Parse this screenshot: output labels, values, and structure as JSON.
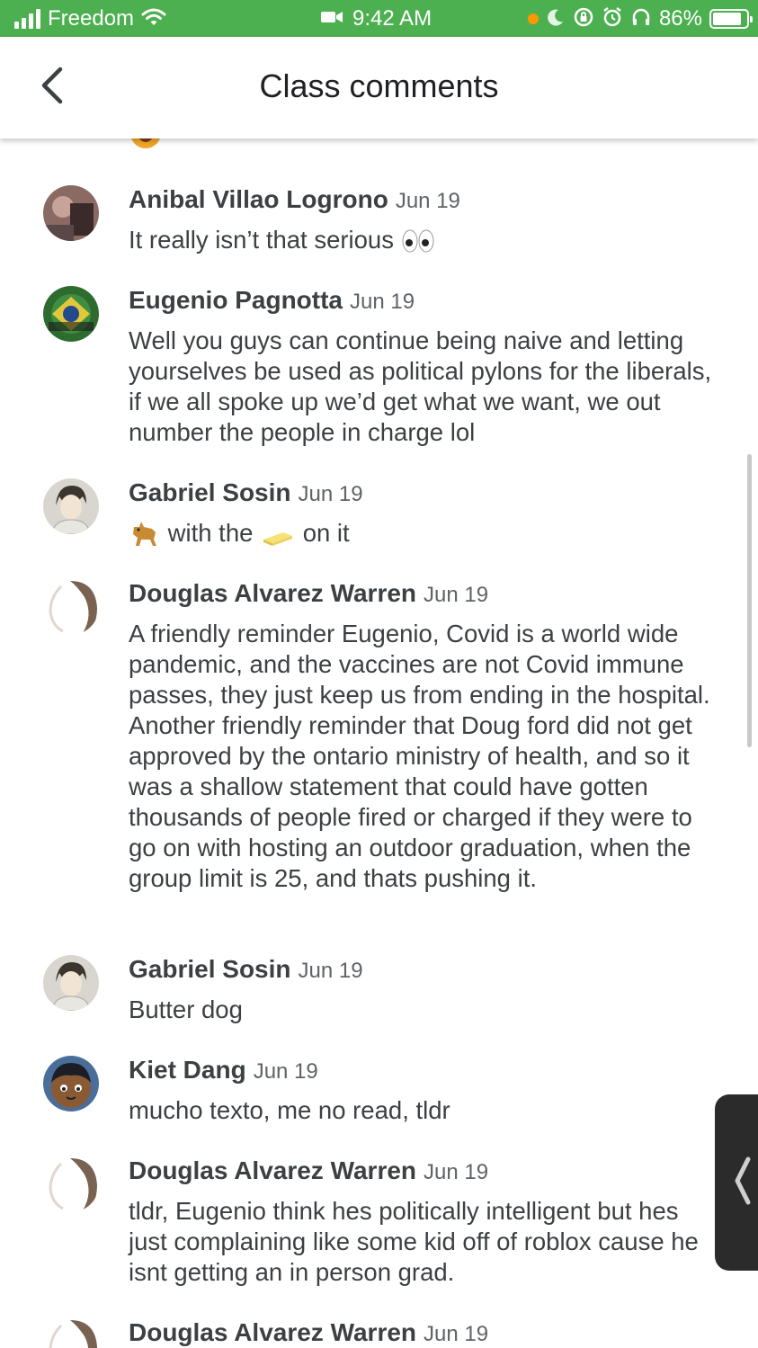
{
  "status_bar": {
    "carrier": "Freedom",
    "time": "9:42 AM",
    "battery_percent": "86%",
    "battery_level": 0.86,
    "background_color": "#4caf50"
  },
  "app_bar": {
    "title": "Class comments",
    "back_icon": "chevron-left-icon"
  },
  "comments": [
    {
      "author": "Anibal Villao Logrono",
      "date": "Jun 19",
      "text": "It really isn’t that serious",
      "trailing_emoji": "eyes-emoji"
    },
    {
      "author": "Eugenio Pagnotta",
      "date": "Jun 19",
      "text": "Well you guys can continue being naive and letting yourselves be used as political pylons for the liberals, if we all spoke up we’d get what we want, we out number the people in charge lol"
    },
    {
      "author": "Gabriel Sosin",
      "date": "Jun 19",
      "text_parts": [
        "with the",
        "on it"
      ],
      "emojis": [
        "dog-emoji",
        "butter-emoji"
      ]
    },
    {
      "author": "Douglas Alvarez Warren",
      "date": "Jun 19",
      "text": "A friendly reminder Eugenio, Covid is a world wide pandemic, and the vaccines are not Covid immune passes, they just keep us from ending in the hospital. Another friendly reminder that Doug ford did not get approved by the ontario ministry of health, and so it was a shallow statement that could have gotten thousands of people fired or charged if they were to go on with hosting an outdoor graduation, when the group limit is 25, and thats pushing it."
    },
    {
      "author": "Gabriel Sosin",
      "date": "Jun 19",
      "text": "Butter dog"
    },
    {
      "author": "Kiet Dang",
      "date": "Jun 19",
      "text": "mucho texto, me no read, tldr"
    },
    {
      "author": "Douglas Alvarez Warren",
      "date": "Jun 19",
      "text": "tldr, Eugenio think hes politically intelligent but hes just complaining like some kid off of roblox cause he isnt getting an in person grad."
    },
    {
      "author": "Douglas Alvarez Warren",
      "date": "Jun 19",
      "text": ""
    }
  ]
}
